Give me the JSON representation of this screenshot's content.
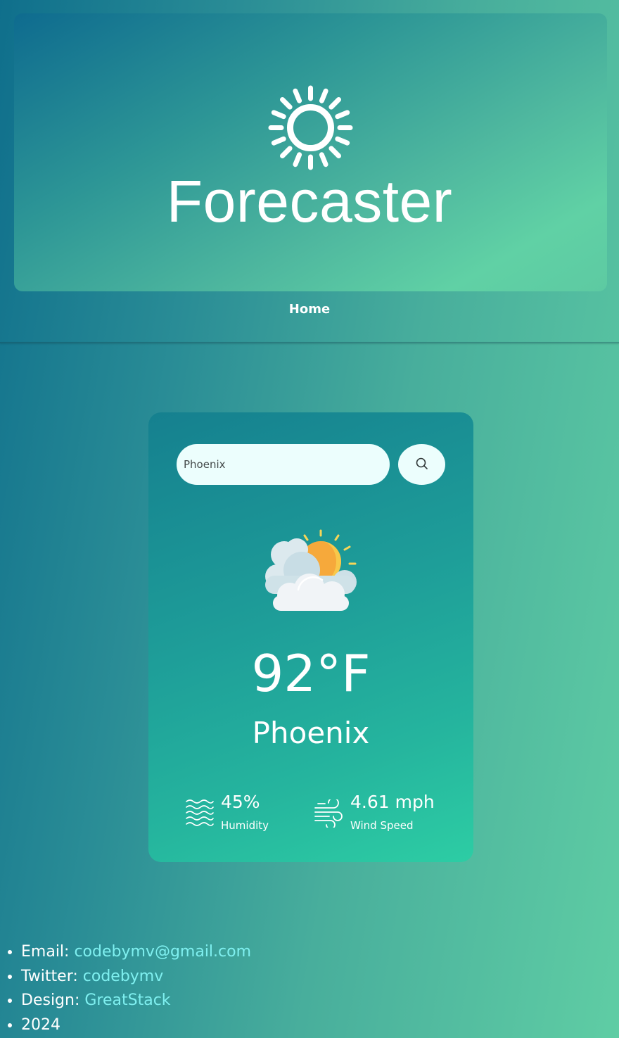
{
  "header": {
    "logo_icon": "sun-icon",
    "title": "Forecaster"
  },
  "nav": {
    "home_label": "Home"
  },
  "weather_card": {
    "search": {
      "value": "Phoenix",
      "button_icon": "search-icon"
    },
    "condition_icon": "partly-cloudy-icon",
    "temperature": "92°F",
    "city": "Phoenix",
    "humidity": {
      "icon": "humidity-waves-icon",
      "value": "45%",
      "label": "Humidity"
    },
    "wind": {
      "icon": "wind-icon",
      "value": "4.61 mph",
      "label": "Wind Speed"
    }
  },
  "footer": {
    "email_label": "Email:",
    "email_value": "codebymv@gmail.com",
    "twitter_label": "Twitter:",
    "twitter_value": "codebymv",
    "design_label": "Design:",
    "design_value": "GreatStack",
    "year": "2024"
  },
  "colors": {
    "page_gradient_start": "#0f6f8c",
    "page_gradient_end": "#5fcda4",
    "card_gradient_start": "#15808f",
    "card_gradient_end": "#2dcda4",
    "input_background": "#ecfefd",
    "link": "#7ff0f0",
    "text": "#ffffff"
  }
}
